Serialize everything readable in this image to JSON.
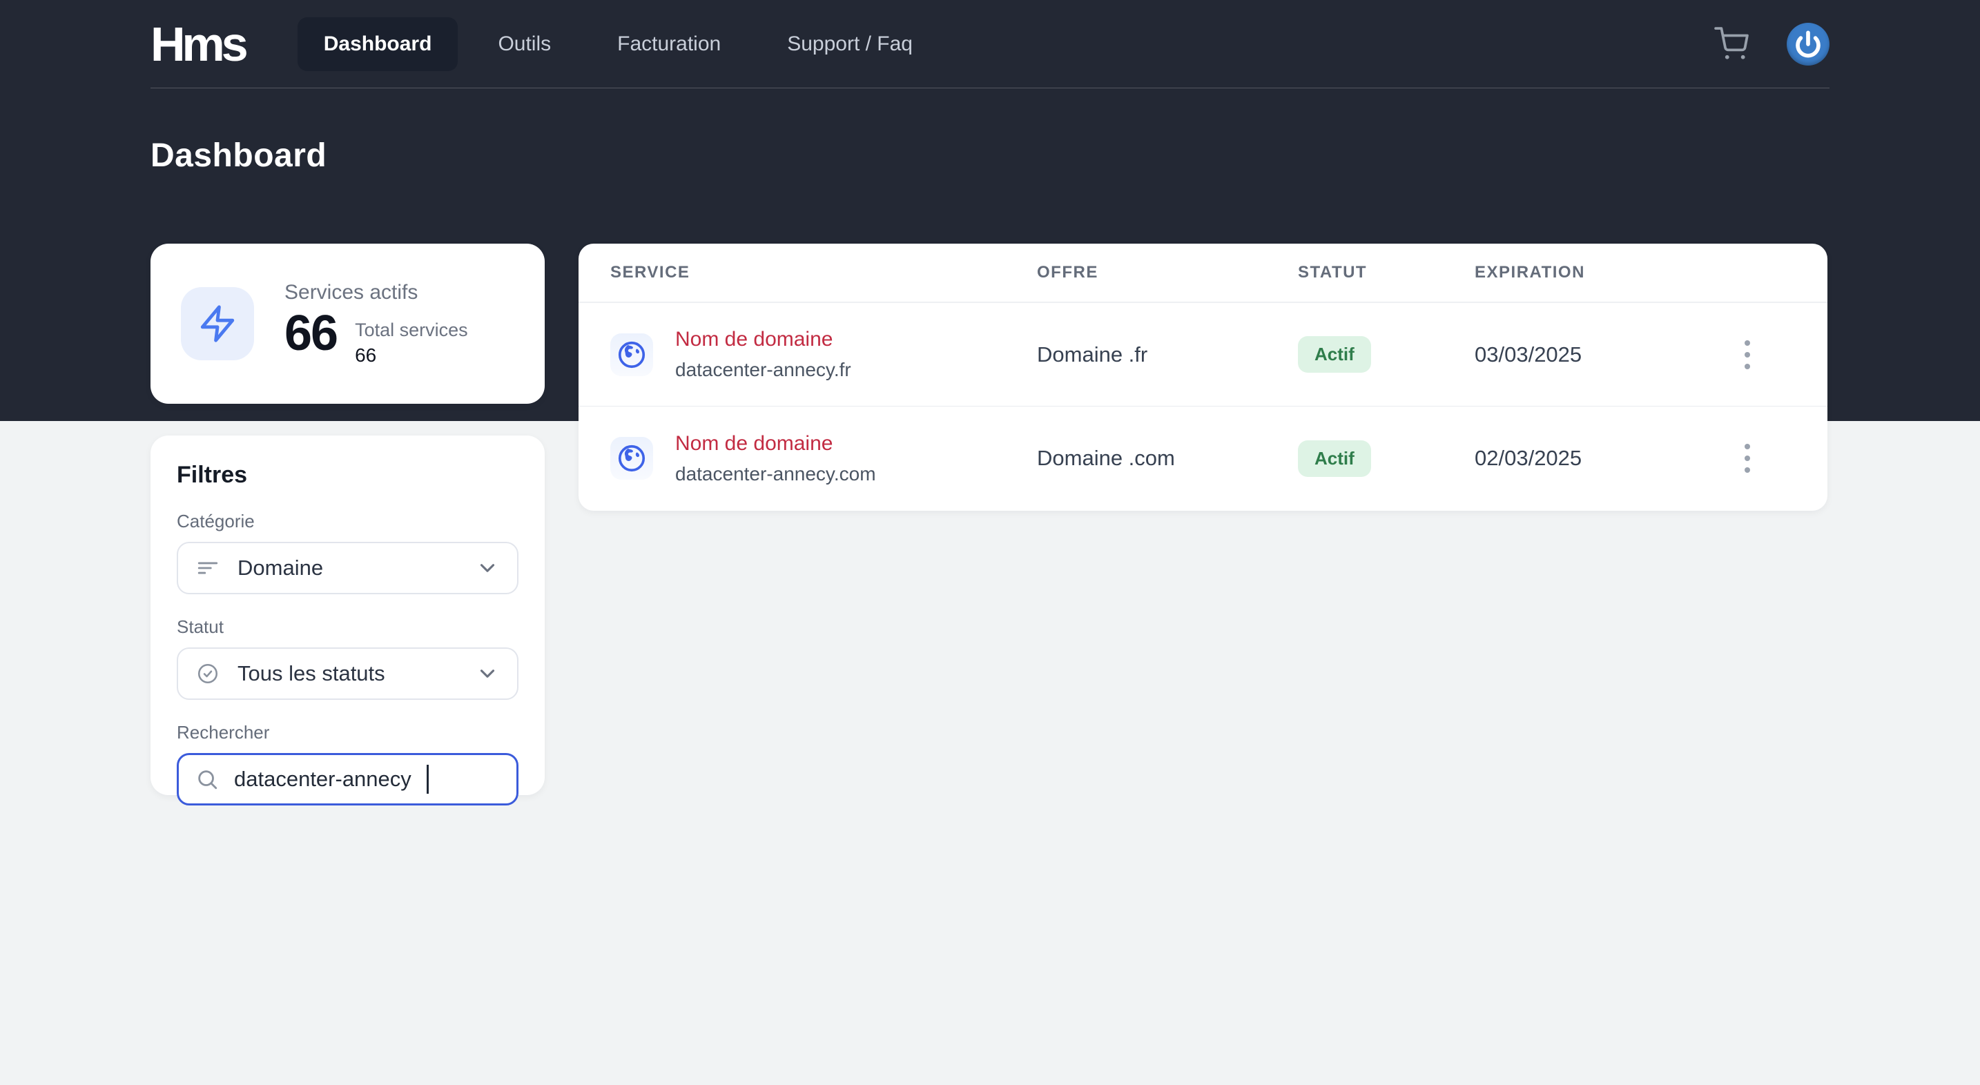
{
  "header": {
    "logo_text": "Hms",
    "nav": [
      {
        "label": "Dashboard",
        "active": true
      },
      {
        "label": "Outils",
        "active": false
      },
      {
        "label": "Facturation",
        "active": false
      },
      {
        "label": "Support / Faq",
        "active": false
      }
    ],
    "icons": {
      "cart": "shopping-cart-icon",
      "power": "power-icon"
    }
  },
  "page": {
    "title": "Dashboard"
  },
  "stats_card": {
    "icon": "lightning-icon",
    "title": "Services actifs",
    "value": "66",
    "total_label": "Total services",
    "total_value": "66"
  },
  "filters": {
    "title": "Filtres",
    "category_label": "Catégorie",
    "category_value": "Domaine",
    "category_icon": "filter-lines-icon",
    "status_label": "Statut",
    "status_value": "Tous les statuts",
    "status_icon": "check-circle-icon",
    "search_label": "Rechercher",
    "search_value": "datacenter-annecy",
    "search_icon": "search-icon"
  },
  "table": {
    "columns": [
      "SERVICE",
      "OFFRE",
      "STATUT",
      "EXPIRATION"
    ],
    "rows": [
      {
        "icon": "globe-icon",
        "service_name": "Nom de domaine",
        "service_sub": "datacenter-annecy.fr",
        "offer": "Domaine .fr",
        "status": "Actif",
        "expiration": "03/03/2025"
      },
      {
        "icon": "globe-icon",
        "service_name": "Nom de domaine",
        "service_sub": "datacenter-annecy.com",
        "offer": "Domaine .com",
        "status": "Actif",
        "expiration": "02/03/2025"
      }
    ]
  },
  "colors": {
    "header_bg": "#232834",
    "active_nav_bg": "#1a202d",
    "page_bg": "#f1f3f4",
    "accent_blue": "#3e68ef",
    "search_focus_border": "#3b5bdb",
    "service_link_red": "#c22b42",
    "badge_bg": "#def3e5",
    "badge_text": "#2f7d4b",
    "power_btn_blue": "#3a7cc7"
  }
}
